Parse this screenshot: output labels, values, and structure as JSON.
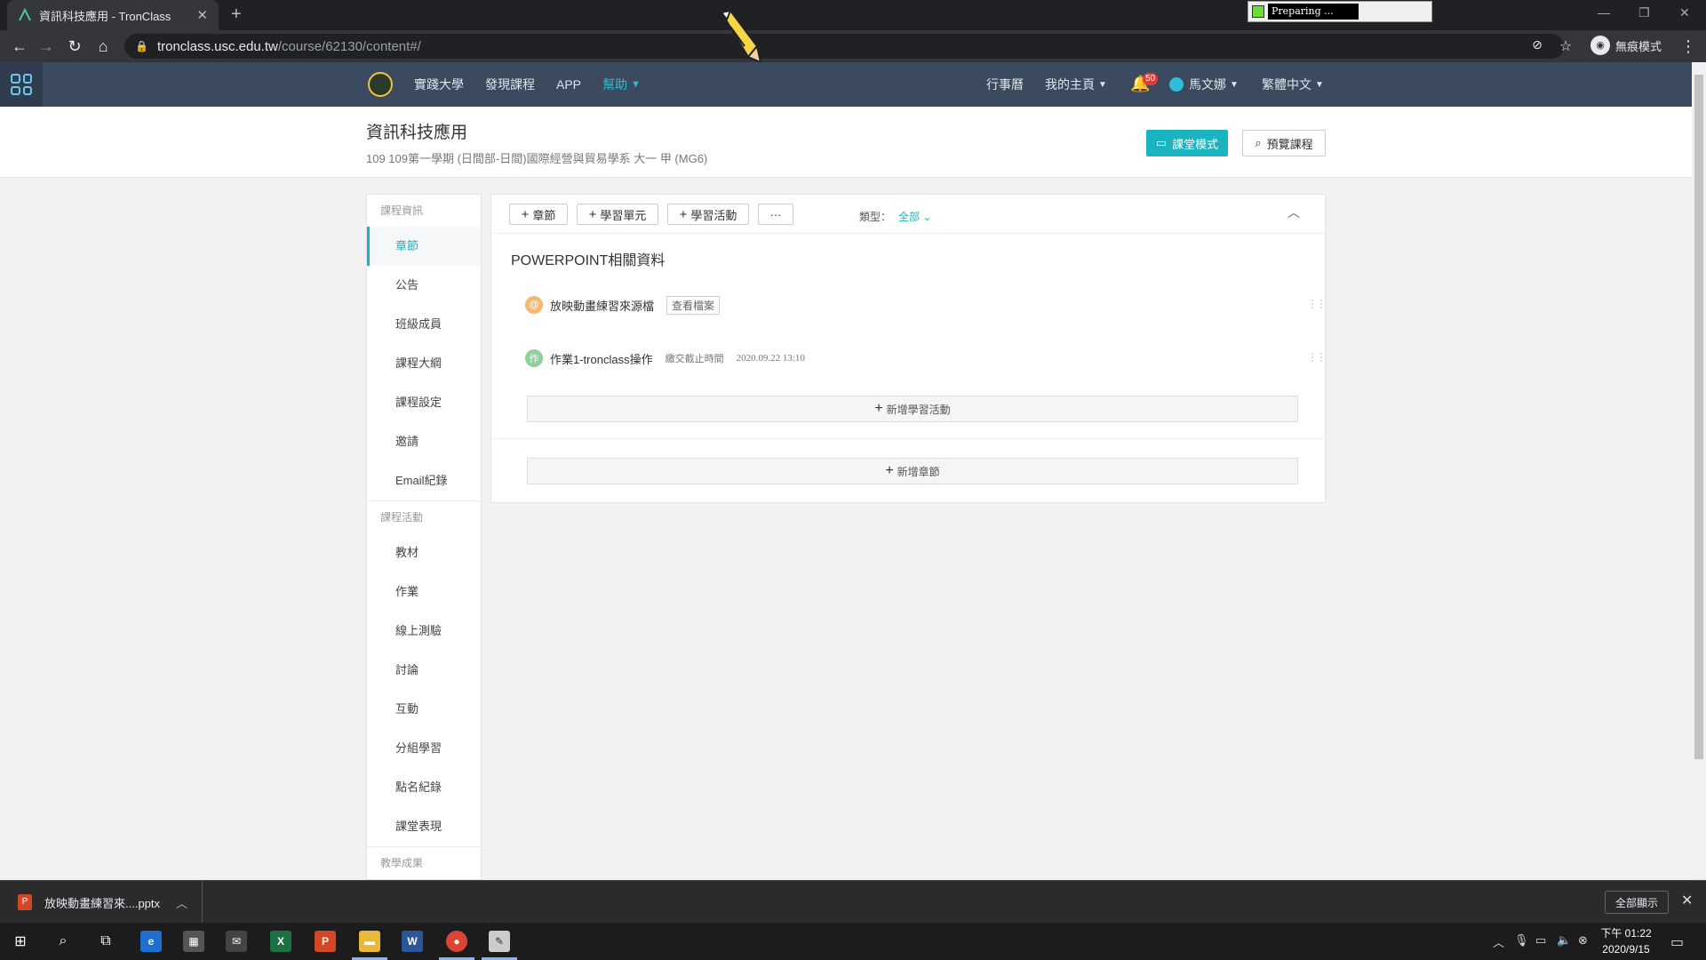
{
  "browser": {
    "tab_title": "資訊科技應用 - TronClass",
    "url_host": "tronclass.usc.edu.tw",
    "url_path": "/course/62130/content#/",
    "incognito_label": "無痕模式",
    "preparing_text": "Preparing ..."
  },
  "site_nav": {
    "items_left": [
      "實踐大學",
      "發現課程",
      "APP",
      "幫助"
    ],
    "calendar": "行事曆",
    "my_home": "我的主頁",
    "notification_count": "50",
    "user_name": "馬文娜",
    "language": "繁體中文"
  },
  "course": {
    "title": "資訊科技應用",
    "subtitle": "109 109第一學期 (日間部-日間)國際經營與貿易學系 大一 甲 (MG6)",
    "class_mode_button": "課堂模式",
    "preview_button": "預覽課程"
  },
  "sidebar": {
    "group1": "課程資訊",
    "group1_items": [
      "章節",
      "公告",
      "班級成員",
      "課程大綱",
      "課程設定",
      "邀請",
      "Email紀錄"
    ],
    "group2": "課程活動",
    "group2_items": [
      "教材",
      "作業",
      "線上測驗",
      "討論",
      "互動",
      "分組學習",
      "點名紀錄",
      "課堂表現"
    ],
    "group3": "教學成果"
  },
  "toolbar": {
    "add_chapter": "章節",
    "add_unit": "學習單元",
    "add_activity": "學習活動",
    "more": "···",
    "type_label": "類型：",
    "type_value": "全部"
  },
  "section": {
    "title": "POWERPOINT相關資料",
    "activities": [
      {
        "icon": "@",
        "name": "放映動畫練習來源檔",
        "tag": "查看檔案",
        "meta": "",
        "date": ""
      },
      {
        "icon": "作",
        "name": "作業1-tronclass操作",
        "tag": "",
        "meta": "繳交截止時間",
        "date": "2020.09.22 13:10"
      }
    ],
    "add_activity_bar": "新增學習活動",
    "add_chapter_bar": "新增章節"
  },
  "download": {
    "file": "放映動畫練習來....pptx",
    "show_all": "全部顯示"
  },
  "taskbar": {
    "time": "下午 01:22",
    "date": "2020/9/15"
  },
  "colors": {
    "accent": "#19b4c0",
    "header_bg": "#3b4a5e"
  }
}
